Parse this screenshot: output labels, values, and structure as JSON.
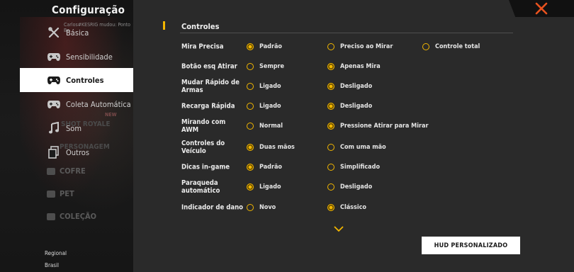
{
  "title": "Configuração",
  "nav": [
    {
      "label": "Básica",
      "icon": "tools-icon"
    },
    {
      "label": "Sensibilidade",
      "icon": "gamepad-icon"
    },
    {
      "label": "Controles",
      "icon": "gamepad-icon",
      "active": true
    },
    {
      "label": "Coleta Automática",
      "icon": "gamepad-icon"
    },
    {
      "label": "Som",
      "icon": "music-note-icon"
    },
    {
      "label": "Outros",
      "icon": "document-icon"
    }
  ],
  "background_menu": [
    "COFRE",
    "PET",
    "COLEÇÃO"
  ],
  "background_overlays": [
    "Carlos#KESRIG mudou: Ponto Ba",
    "NEW",
    "SHOT ROYALE",
    "PERSONAGEM"
  ],
  "region": {
    "label": "Regional",
    "value": "Brasil"
  },
  "section": {
    "title": "Controles"
  },
  "rows": [
    {
      "label": "Mira Precisa",
      "options": [
        {
          "text": "Padrão",
          "selected": true
        },
        {
          "text": "Preciso ao Mirar",
          "selected": false
        },
        {
          "text": "Controle total",
          "selected": false
        }
      ]
    },
    {
      "label": "Botão esq Atirar",
      "options": [
        {
          "text": "Sempre",
          "selected": false
        },
        {
          "text": "Apenas Mira",
          "selected": true
        }
      ]
    },
    {
      "label": "Mudar Rápido de Armas",
      "options": [
        {
          "text": "Ligado",
          "selected": false
        },
        {
          "text": "Desligado",
          "selected": true
        }
      ]
    },
    {
      "label": "Recarga Rápida",
      "options": [
        {
          "text": "Ligado",
          "selected": false
        },
        {
          "text": "Desligado",
          "selected": true
        }
      ]
    },
    {
      "label": "Mirando com AWM",
      "options": [
        {
          "text": "Normal",
          "selected": false
        },
        {
          "text": "Pressione Atirar para Mirar",
          "selected": true
        }
      ]
    },
    {
      "label": "Controles do Veículo",
      "options": [
        {
          "text": "Duas mãos",
          "selected": true
        },
        {
          "text": "Com uma mão",
          "selected": false
        }
      ]
    },
    {
      "label": "Dicas in-game",
      "options": [
        {
          "text": "Padrão",
          "selected": true
        },
        {
          "text": "Simplificado",
          "selected": false
        }
      ]
    },
    {
      "label": "Paraqueda automático",
      "options": [
        {
          "text": "Ligado",
          "selected": true
        },
        {
          "text": "Desligado",
          "selected": false
        }
      ]
    },
    {
      "label": "Indicador de dano",
      "options": [
        {
          "text": "Novo",
          "selected": false
        },
        {
          "text": "Clássico",
          "selected": true
        }
      ]
    }
  ],
  "hud_button": "HUD PERSONALIZADO",
  "colors": {
    "accent": "#f2b600",
    "close": "#e8521e",
    "panel": "#2a2a2a",
    "sidebar": "#161616"
  }
}
